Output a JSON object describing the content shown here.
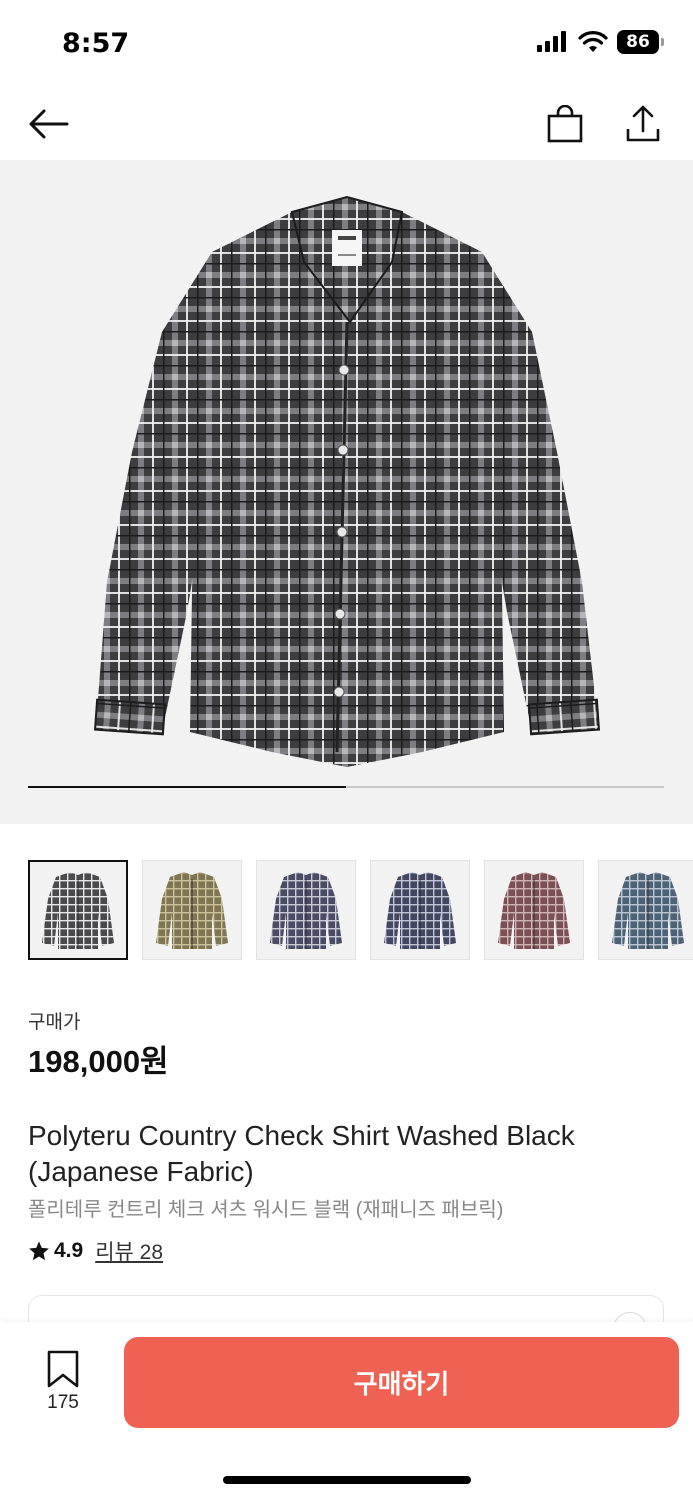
{
  "status_bar": {
    "time": "8:57",
    "battery": "86"
  },
  "nav": {
    "back_icon": "back-arrow-icon",
    "bag_icon": "shopping-bag-icon",
    "share_icon": "share-icon"
  },
  "gallery": {
    "progress": 0.5,
    "thumbnails": [
      {
        "color": "#4a4a4c",
        "line": "#e6e6e6",
        "selected": true
      },
      {
        "color": "#7f7552",
        "line": "#c9c29a",
        "selected": false
      },
      {
        "color": "#4a4c63",
        "line": "#c8cad8",
        "selected": false
      },
      {
        "color": "#434760",
        "line": "#bfc3d6",
        "selected": false
      },
      {
        "color": "#7a4f55",
        "line": "#cfb3b3",
        "selected": false
      },
      {
        "color": "#4f6377",
        "line": "#b9c7d4",
        "selected": false
      }
    ]
  },
  "product": {
    "price_label": "구매가",
    "price": "198,000원",
    "title": "Polyteru Country Check Shirt Washed Black (Japanese Fabric)",
    "subtitle": "폴리테루 컨트리 체크 셔츠 워시드 블랙 (재패니즈 패브릭)",
    "rating_icon": "star-icon",
    "rating": "4.9",
    "review_link": "리뷰 28"
  },
  "bottom_bar": {
    "bookmark_icon": "bookmark-icon",
    "bookmark_count": "175",
    "buy_label": "구매하기"
  },
  "colors": {
    "buy_button": "#ef6253",
    "hero_background": "#f2f2f2"
  }
}
